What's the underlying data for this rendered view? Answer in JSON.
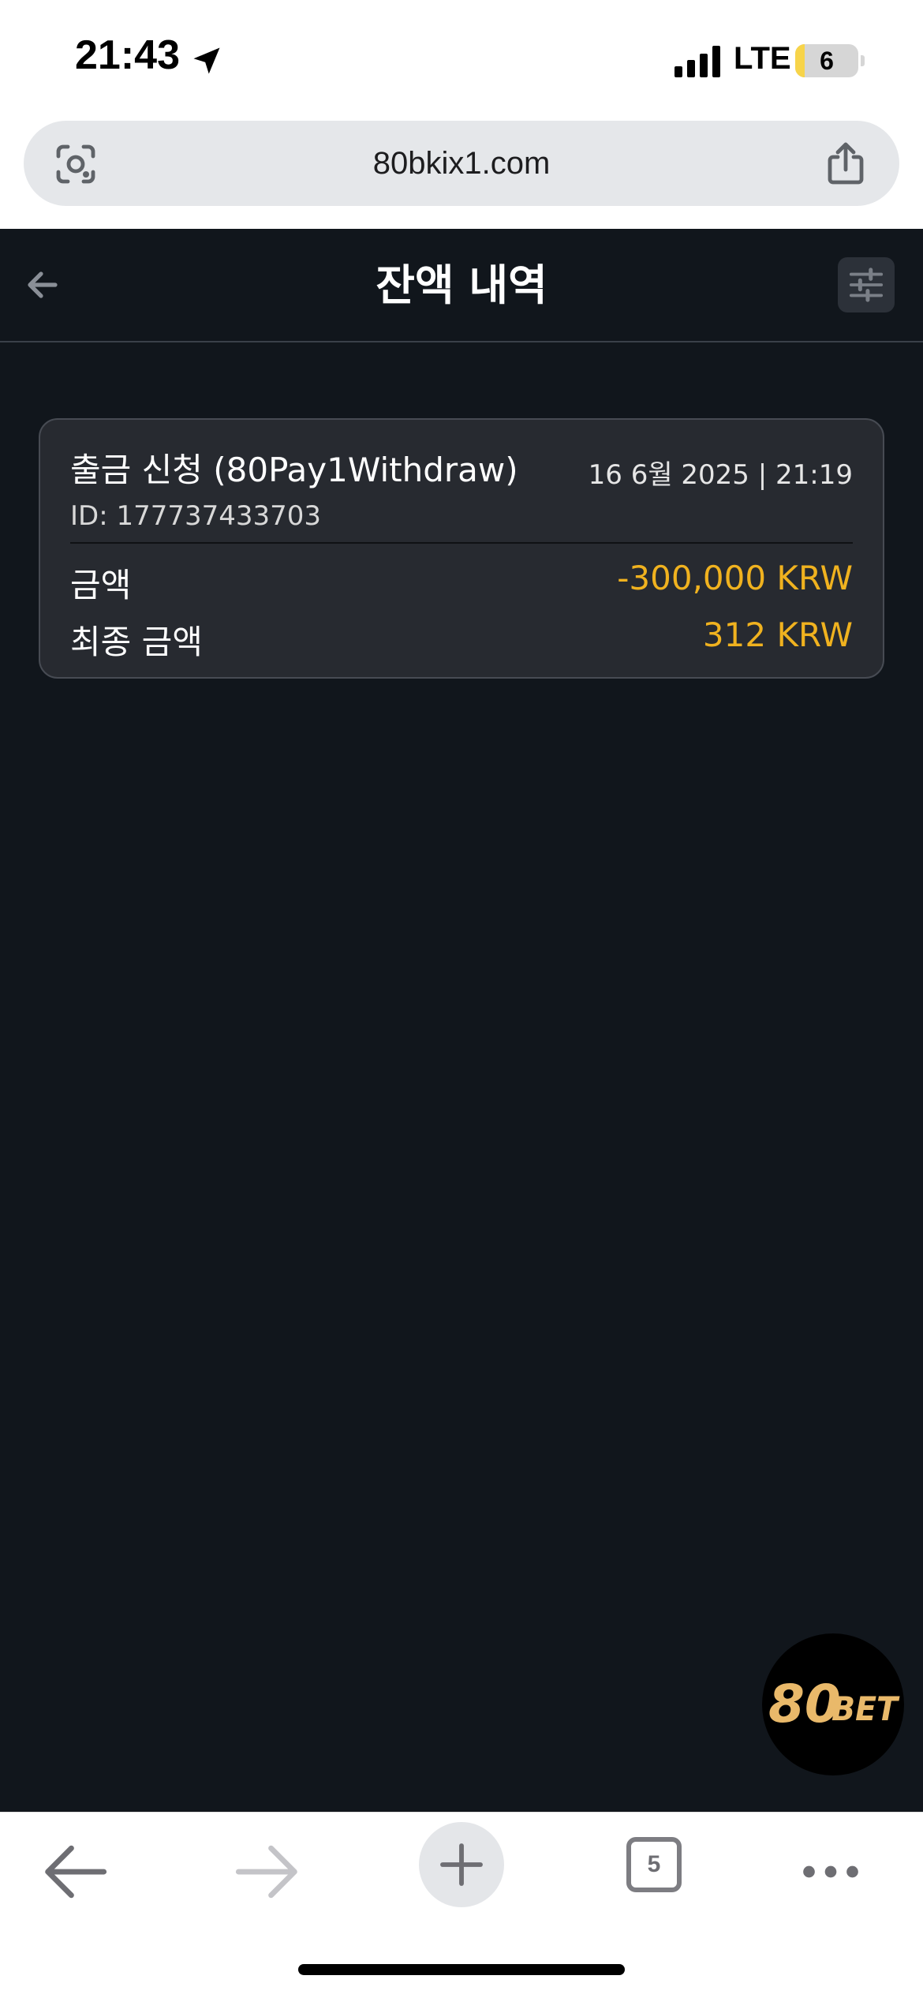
{
  "status_bar": {
    "time": "21:43",
    "network": "LTE",
    "battery": "6",
    "battery_level_percent": 6
  },
  "browser": {
    "url": "80bkix1.com",
    "tab_count": "5"
  },
  "header": {
    "title": "잔액 내역"
  },
  "transaction": {
    "title": "출금 신청 (80Pay1Withdraw)",
    "date": "16 6월 2025 | 21:19",
    "id": "ID: 177737433703",
    "amount_label": "금액",
    "amount_value": "-300,000 KRW",
    "final_label": "최종 금액",
    "final_value": "312 KRW"
  },
  "brand": {
    "logo_number": "80",
    "logo_word": "BET"
  },
  "colors": {
    "page_background": "#11161c",
    "card_background": "#272a30",
    "accent_amount": "#f0b21f",
    "logo_gold": "#e9b96a"
  },
  "icons": {
    "location": "location-arrow-icon",
    "signal": "cellular-signal-icon",
    "lens": "camera-lens-icon",
    "share": "share-icon",
    "back": "arrow-left-icon",
    "filter": "sliders-icon",
    "forward": "arrow-right-icon",
    "new_tab": "plus-icon",
    "more": "ellipsis-icon"
  }
}
